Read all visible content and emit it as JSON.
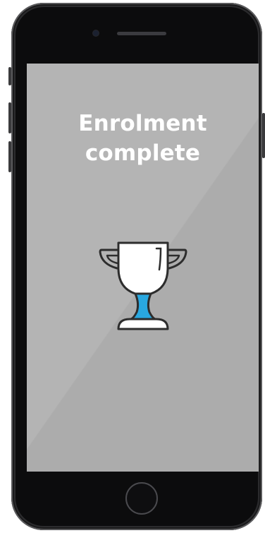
{
  "screen": {
    "title_line1": "Enrolment",
    "title_line2": "complete",
    "background_color": "#acacac",
    "text_color": "#ffffff"
  },
  "icons": {
    "trophy": "trophy-icon",
    "home": "home-button"
  },
  "colors": {
    "accent": "#29a8e0",
    "phone_body": "#2b2b2d",
    "bezel": "#0c0c0d"
  }
}
